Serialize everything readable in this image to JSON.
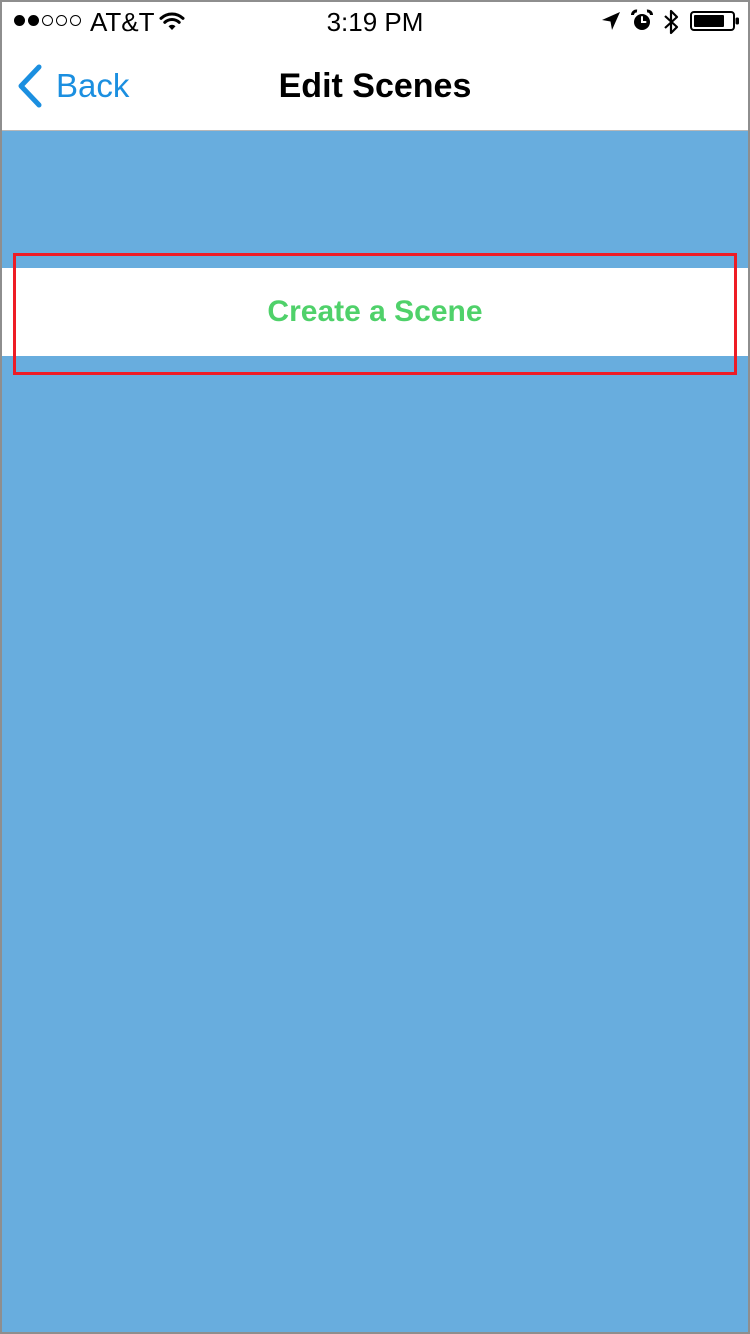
{
  "status_bar": {
    "carrier": "AT&T",
    "time": "3:19 PM",
    "signal_bars_filled": 2,
    "signal_bars_total": 5,
    "icons": [
      "signal-dots-icon",
      "wifi-icon",
      "location-arrow-icon",
      "alarm-clock-icon",
      "bluetooth-icon",
      "battery-icon"
    ]
  },
  "nav": {
    "back_label": "Back",
    "title": "Edit Scenes"
  },
  "scenes": {
    "create_label": "Create a Scene"
  },
  "colors": {
    "background": "#68adde",
    "accent_blue": "#1b8fe0",
    "create_green": "#4fd16a",
    "highlight_red": "#ee1c25"
  }
}
